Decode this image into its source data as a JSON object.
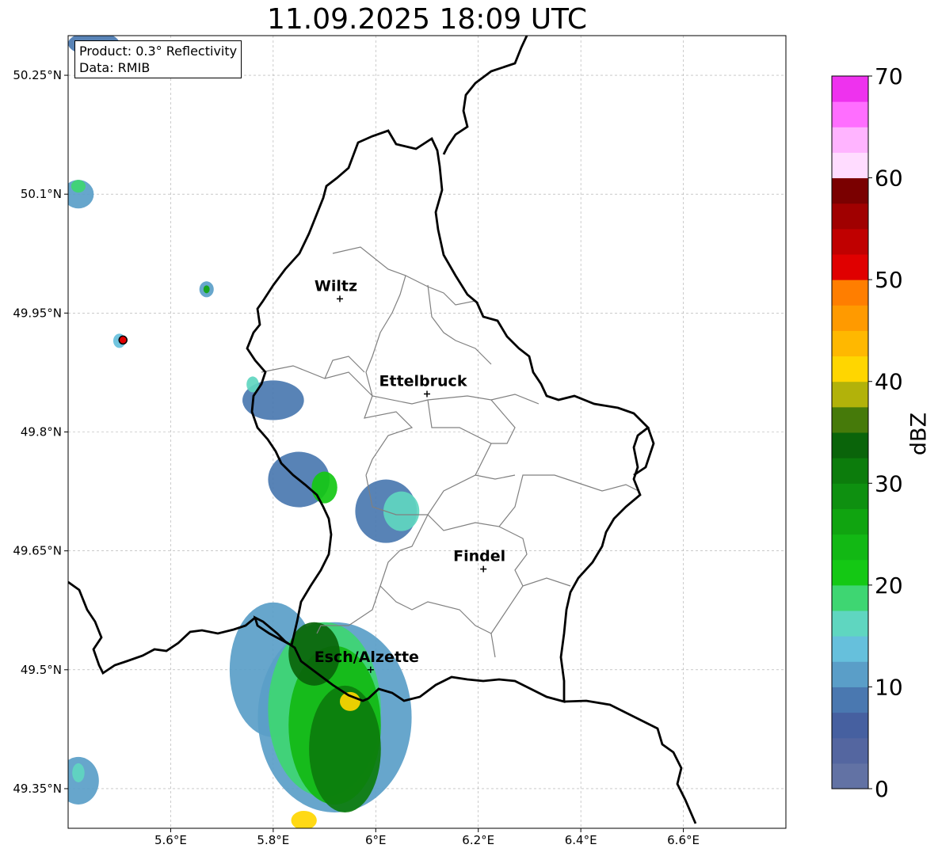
{
  "title": "11.09.2025 18:09 UTC",
  "info": {
    "product": "Product: 0.3° Reflectivity",
    "data": "Data: RMIB"
  },
  "map_extent": {
    "lon": [
      5.4,
      6.8
    ],
    "lat": [
      49.3,
      50.3
    ]
  },
  "lat_ticks": [
    {
      "value": 50.25,
      "label": "50.25°N"
    },
    {
      "value": 50.1,
      "label": "50.1°N"
    },
    {
      "value": 49.95,
      "label": "49.95°N"
    },
    {
      "value": 49.8,
      "label": "49.8°N"
    },
    {
      "value": 49.65,
      "label": "49.65°N"
    },
    {
      "value": 49.5,
      "label": "49.5°N"
    },
    {
      "value": 49.35,
      "label": "49.35°N"
    }
  ],
  "lon_ticks": [
    {
      "value": 5.6,
      "label": "5.6°E"
    },
    {
      "value": 5.8,
      "label": "5.8°E"
    },
    {
      "value": 6.0,
      "label": "6°E"
    },
    {
      "value": 6.2,
      "label": "6.2°E"
    },
    {
      "value": 6.4,
      "label": "6.4°E"
    },
    {
      "value": 6.6,
      "label": "6.6°E"
    }
  ],
  "cities": [
    {
      "name": "Wiltz",
      "lon": 5.93,
      "lat": 49.968
    },
    {
      "name": "Ettelbruck",
      "lon": 6.1,
      "lat": 49.848
    },
    {
      "name": "Findel",
      "lon": 6.21,
      "lat": 49.627
    },
    {
      "name": "Esch/Alzette",
      "lon": 5.99,
      "lat": 49.5
    }
  ],
  "colorbar": {
    "label": "dBZ",
    "min": 0,
    "max": 70,
    "step": 2.5,
    "ticks": [
      "0",
      "10",
      "20",
      "30",
      "40",
      "50",
      "60",
      "70"
    ],
    "colors": [
      "#6272a4",
      "#5466a0",
      "#4660a0",
      "#4a78b0",
      "#5a9ec8",
      "#66c0dc",
      "#5fd6c0",
      "#3ed672",
      "#14c814",
      "#12b814",
      "#10a410",
      "#0e9010",
      "#0c7c0c",
      "#0a640a",
      "#467a0a",
      "#b2b20a",
      "#ffd600",
      "#ffb800",
      "#ff9a00",
      "#ff7e00",
      "#e00000",
      "#c00000",
      "#a00000",
      "#7a0000",
      "#ffdcff",
      "#ffb4ff",
      "#ff6eff",
      "#ee32ee"
    ]
  },
  "radar_cells": [
    {
      "lon": 5.8,
      "lat": 49.5,
      "rlon": 0.085,
      "rlat": 0.085,
      "dbz": 10
    },
    {
      "lon": 5.92,
      "lat": 49.44,
      "rlon": 0.15,
      "rlat": 0.12,
      "dbz": 10
    },
    {
      "lon": 5.9,
      "lat": 49.45,
      "rlon": 0.11,
      "rlat": 0.11,
      "dbz": 18
    },
    {
      "lon": 5.92,
      "lat": 49.43,
      "rlon": 0.09,
      "rlat": 0.1,
      "dbz": 24
    },
    {
      "lon": 5.94,
      "lat": 49.4,
      "rlon": 0.07,
      "rlat": 0.08,
      "dbz": 30
    },
    {
      "lon": 5.88,
      "lat": 49.52,
      "rlon": 0.05,
      "rlat": 0.04,
      "dbz": 33
    },
    {
      "lon": 5.95,
      "lat": 49.46,
      "rlon": 0.02,
      "rlat": 0.012,
      "dbz": 42
    },
    {
      "lon": 5.86,
      "lat": 49.31,
      "rlon": 0.025,
      "rlat": 0.012,
      "dbz": 42
    },
    {
      "lon": 6.02,
      "lat": 49.7,
      "rlon": 0.06,
      "rlat": 0.04,
      "dbz": 8
    },
    {
      "lon": 6.05,
      "lat": 49.7,
      "rlon": 0.035,
      "rlat": 0.025,
      "dbz": 16
    },
    {
      "lon": 5.85,
      "lat": 49.74,
      "rlon": 0.06,
      "rlat": 0.035,
      "dbz": 8
    },
    {
      "lon": 5.9,
      "lat": 49.73,
      "rlon": 0.025,
      "rlat": 0.02,
      "dbz": 22
    },
    {
      "lon": 5.8,
      "lat": 49.84,
      "rlon": 0.06,
      "rlat": 0.025,
      "dbz": 8
    },
    {
      "lon": 5.76,
      "lat": 49.86,
      "rlon": 0.012,
      "rlat": 0.01,
      "dbz": 16
    },
    {
      "lon": 5.5,
      "lat": 49.915,
      "rlon": 0.012,
      "rlat": 0.009,
      "dbz": 14
    },
    {
      "lon": 5.67,
      "lat": 49.98,
      "rlon": 0.014,
      "rlat": 0.01,
      "dbz": 12
    },
    {
      "lon": 5.67,
      "lat": 49.98,
      "rlon": 0.006,
      "rlat": 0.005,
      "dbz": 26
    },
    {
      "lon": 5.42,
      "lat": 50.1,
      "rlon": 0.03,
      "rlat": 0.018,
      "dbz": 10
    },
    {
      "lon": 5.42,
      "lat": 50.11,
      "rlon": 0.014,
      "rlat": 0.008,
      "dbz": 18
    },
    {
      "lon": 5.45,
      "lat": 50.29,
      "rlon": 0.05,
      "rlat": 0.015,
      "dbz": 8
    },
    {
      "lon": 5.42,
      "lat": 49.36,
      "rlon": 0.04,
      "rlat": 0.03,
      "dbz": 10
    },
    {
      "lon": 5.42,
      "lat": 49.37,
      "rlon": 0.012,
      "rlat": 0.012,
      "dbz": 16
    }
  ],
  "marker": {
    "lon": 5.507,
    "lat": 49.916
  }
}
